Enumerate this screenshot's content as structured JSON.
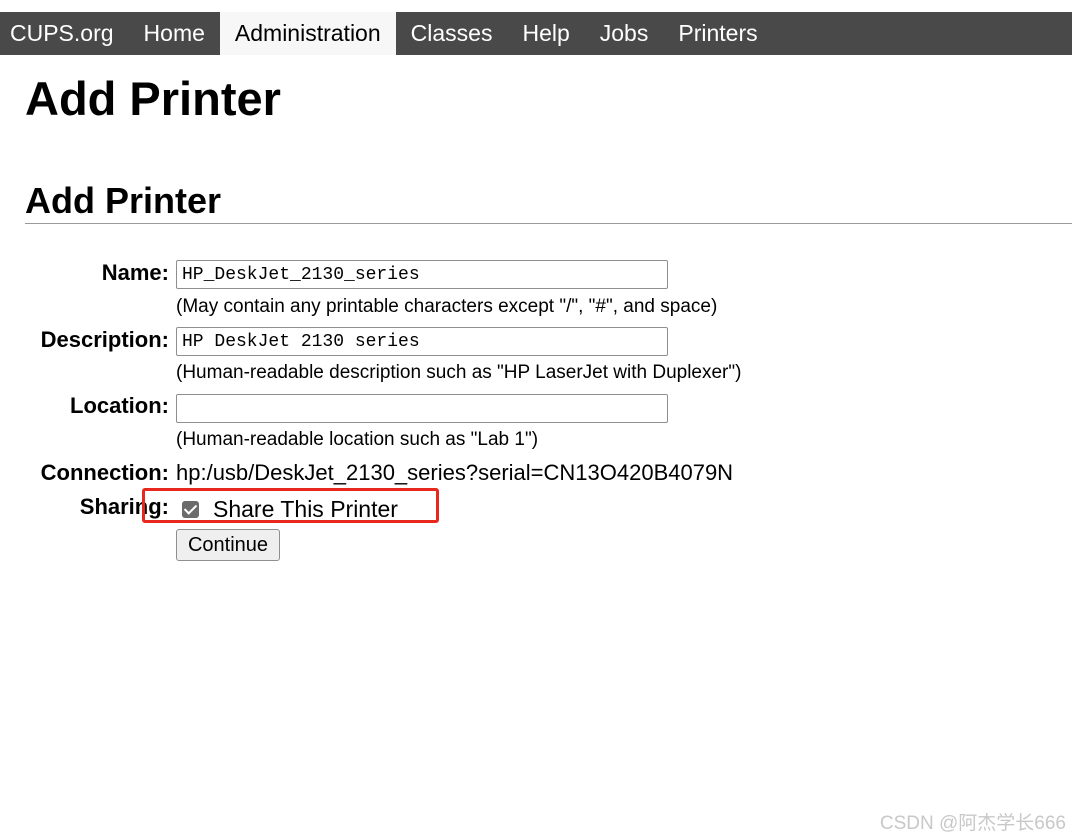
{
  "nav": {
    "items": [
      {
        "label": "CUPS.org"
      },
      {
        "label": "Home"
      },
      {
        "label": "Administration",
        "active": true
      },
      {
        "label": "Classes"
      },
      {
        "label": "Help"
      },
      {
        "label": "Jobs"
      },
      {
        "label": "Printers"
      }
    ]
  },
  "page_title": "Add Printer",
  "section_title": "Add Printer",
  "form": {
    "name": {
      "label": "Name:",
      "value": "HP_DeskJet_2130_series",
      "hint": "(May contain any printable characters except \"/\", \"#\", and space)"
    },
    "description": {
      "label": "Description:",
      "value": "HP DeskJet 2130 series",
      "hint": "(Human-readable description such as \"HP LaserJet with Duplexer\")"
    },
    "location": {
      "label": "Location:",
      "value": "",
      "hint": "(Human-readable location such as \"Lab 1\")"
    },
    "connection": {
      "label": "Connection:",
      "value": "hp:/usb/DeskJet_2130_series?serial=CN13O420B4079N"
    },
    "sharing": {
      "label": "Sharing:",
      "checkbox_label": "Share This Printer",
      "checked": true
    },
    "continue_label": "Continue"
  },
  "highlight_color": "#e8271f",
  "watermark": "CSDN @阿杰学长666"
}
